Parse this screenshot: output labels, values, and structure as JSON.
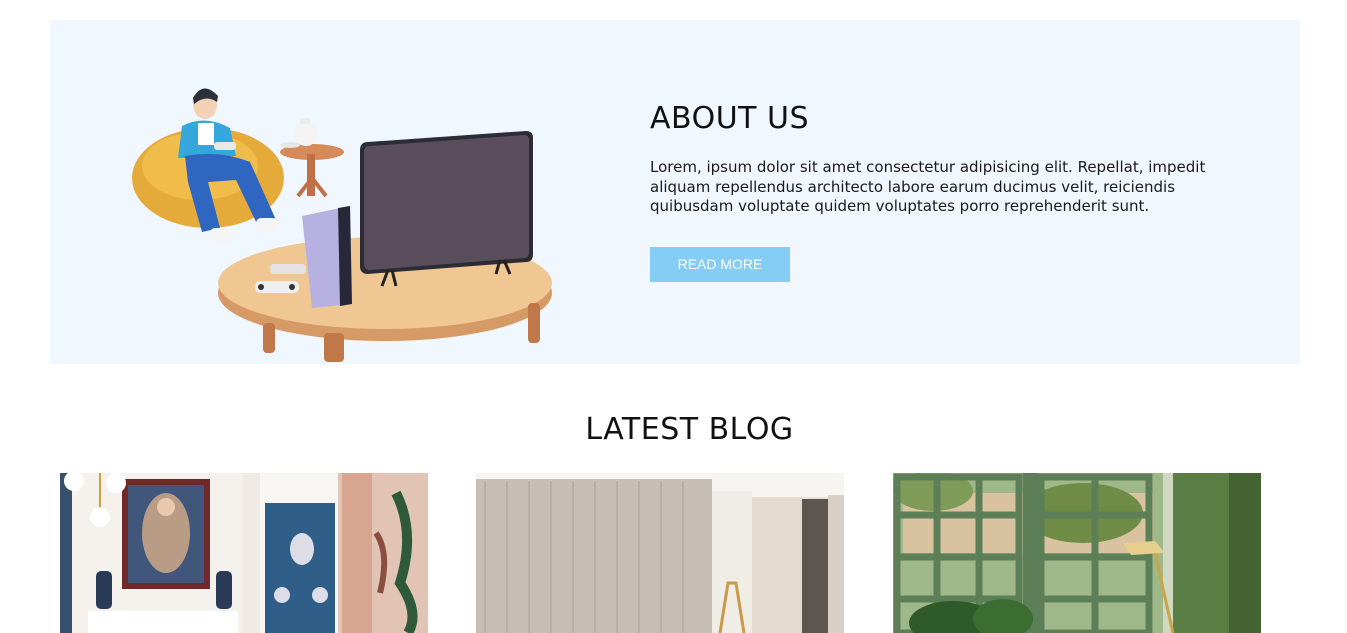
{
  "about": {
    "title": "ABOUT US",
    "text": "Lorem, ipsum dolor sit amet consectetur adipisicing elit. Repellat, impedit aliquam repellendus architecto labore earum ducimus velit, reiciendis quibusdam voluptate quidem voluptates porro reprehenderit sunt.",
    "button_label": "READ MORE",
    "illustration": "person-gaming-illustration"
  },
  "blog": {
    "title": "LATEST BLOG",
    "posts": [
      {
        "image": "classic-interior-photo"
      },
      {
        "image": "paneled-wall-interior-photo"
      },
      {
        "image": "green-window-interior-photo"
      }
    ]
  },
  "colors": {
    "about_bg": "#f0f7fe",
    "button_bg": "#84cdf5",
    "button_text": "#ffffff"
  }
}
